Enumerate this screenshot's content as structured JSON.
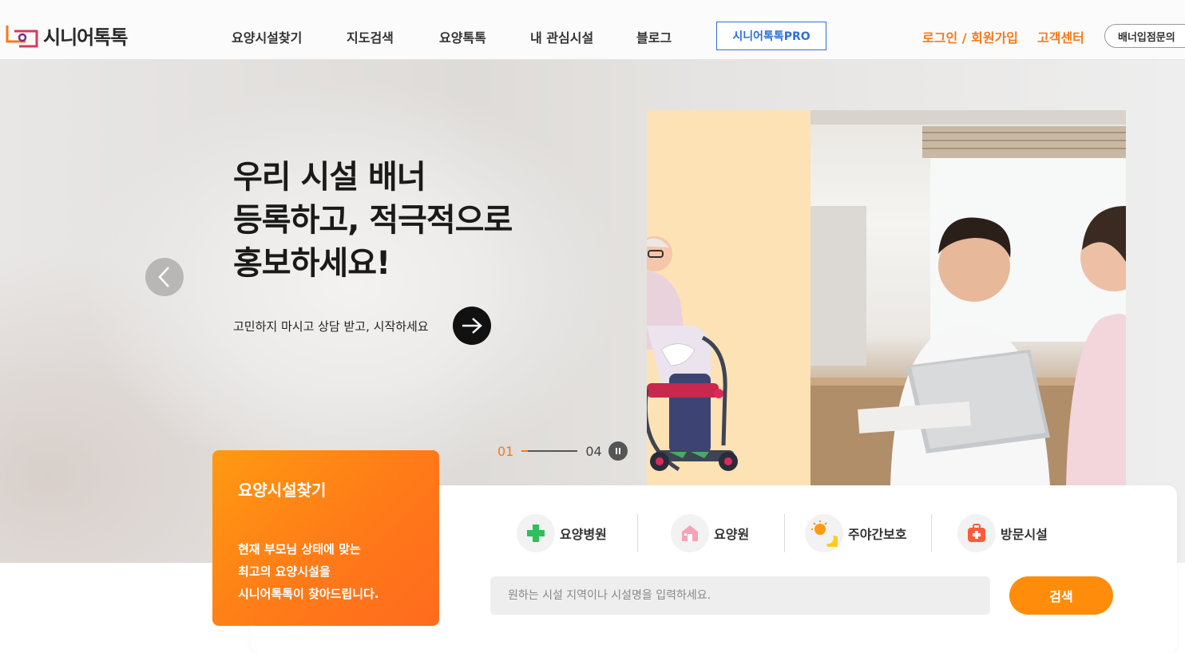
{
  "header": {
    "logo_text": "시니어톡톡",
    "nav": [
      "요양시설찾기",
      "지도검색",
      "요양톡톡",
      "내 관심시설",
      "블로그"
    ],
    "pro_label": "시니어톡톡PRO",
    "login_label": "로그인 / 회원가입",
    "cs_label": "고객센터",
    "banner_label": "배너입점문의"
  },
  "hero": {
    "title_lines": [
      "우리 시설 배너",
      "등록하고, 적극적으로",
      "홍보하세요!"
    ],
    "subtitle": "고민하지 마시고 상담 받고, 시작하세요",
    "pager_current": "01",
    "pager_total": "04"
  },
  "search": {
    "card_title": "요양시설찾기",
    "card_desc": [
      "현재 부모님 상태에 맞는",
      "최고의 요양시설을",
      "시니어톡톡이 찾아드립니다."
    ],
    "categories": [
      {
        "label": "요양병원",
        "icon": "medical-cross-icon"
      },
      {
        "label": "요양원",
        "icon": "home-icon"
      },
      {
        "label": "주야간보호",
        "icon": "sun-moon-icon"
      },
      {
        "label": "방문시설",
        "icon": "first-aid-bag-icon"
      }
    ],
    "placeholder": "원하는 시설 지역이나 시설명을 입력하세요.",
    "button_label": "검색"
  },
  "colors": {
    "accent": "#f7791b",
    "pro_blue": "#2f6fd8",
    "search_button": "#ff8c0a"
  }
}
